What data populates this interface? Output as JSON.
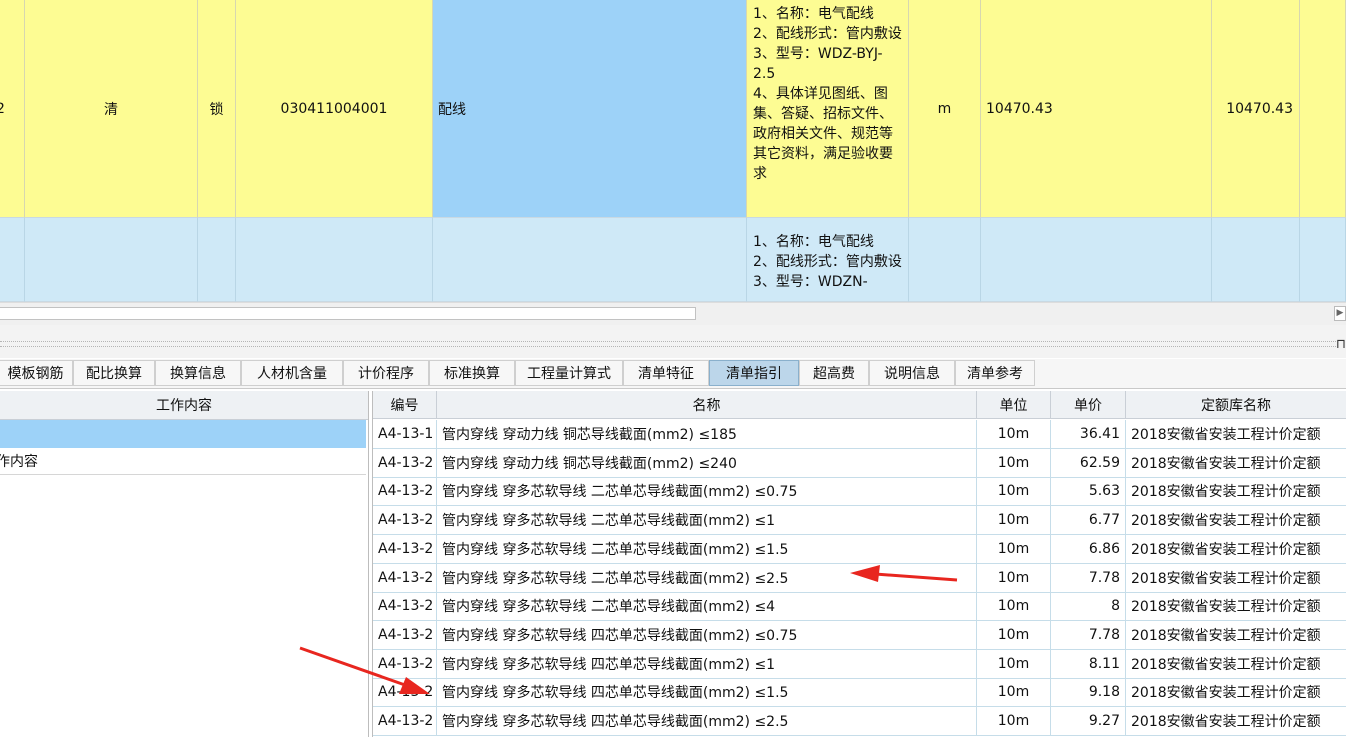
{
  "top_grid": {
    "row1": {
      "seq": "2",
      "type": "清",
      "lock": "锁",
      "code": "030411004001",
      "name": "配线",
      "features": [
        "1、名称：电气配线",
        "2、配线形式：管内敷设",
        "3、型号：WDZ-BYJ-2.5",
        "4、具体详见图纸、图集、答疑、招标文件、政府相关文件、规范等其它资料，满足验收要求"
      ],
      "unit": "m",
      "quantity": "10470.43",
      "quantity2": "10470.43"
    },
    "row2": {
      "features": [
        "1、名称：电气配线",
        "2、配线形式：管内敷设",
        "3、型号：WDZN-"
      ]
    }
  },
  "tabs": [
    {
      "label": "模板钢筋",
      "active": false
    },
    {
      "label": "配比换算",
      "active": false
    },
    {
      "label": "换算信息",
      "active": false
    },
    {
      "label": "人材机含量",
      "active": false
    },
    {
      "label": "计价程序",
      "active": false
    },
    {
      "label": "标准换算",
      "active": false
    },
    {
      "label": "工程量计算式",
      "active": false
    },
    {
      "label": "清单特征",
      "active": false
    },
    {
      "label": "清单指引",
      "active": true
    },
    {
      "label": "超高费",
      "active": false
    },
    {
      "label": "说明信息",
      "active": false
    },
    {
      "label": "清单参考",
      "active": false
    }
  ],
  "left_panel": {
    "header": "工作内容",
    "rows": [
      "",
      "作内容"
    ]
  },
  "quota_table": {
    "headers": [
      "编号",
      "名称",
      "单位",
      "单价",
      "定额库名称"
    ],
    "rows": [
      {
        "code": "A4-13-1",
        "name": "管内穿线 穿动力线 铜芯导线截面(mm2) ≤185",
        "unit": "10m",
        "price": "36.41",
        "lib": "2018安徽省安装工程计价定额"
      },
      {
        "code": "A4-13-2",
        "name": "管内穿线 穿动力线 铜芯导线截面(mm2) ≤240",
        "unit": "10m",
        "price": "62.59",
        "lib": "2018安徽省安装工程计价定额"
      },
      {
        "code": "A4-13-2",
        "name": "管内穿线 穿多芯软导线 二芯单芯导线截面(mm2) ≤0.75",
        "unit": "10m",
        "price": "5.63",
        "lib": "2018安徽省安装工程计价定额"
      },
      {
        "code": "A4-13-2",
        "name": "管内穿线 穿多芯软导线 二芯单芯导线截面(mm2) ≤1",
        "unit": "10m",
        "price": "6.77",
        "lib": "2018安徽省安装工程计价定额"
      },
      {
        "code": "A4-13-2",
        "name": "管内穿线 穿多芯软导线 二芯单芯导线截面(mm2) ≤1.5",
        "unit": "10m",
        "price": "6.86",
        "lib": "2018安徽省安装工程计价定额"
      },
      {
        "code": "A4-13-2",
        "name": "管内穿线 穿多芯软导线 二芯单芯导线截面(mm2) ≤2.5",
        "unit": "10m",
        "price": "7.78",
        "lib": "2018安徽省安装工程计价定额"
      },
      {
        "code": "A4-13-2",
        "name": "管内穿线 穿多芯软导线 二芯单芯导线截面(mm2) ≤4",
        "unit": "10m",
        "price": "8",
        "lib": "2018安徽省安装工程计价定额"
      },
      {
        "code": "A4-13-2",
        "name": "管内穿线 穿多芯软导线 四芯单芯导线截面(mm2) ≤0.75",
        "unit": "10m",
        "price": "7.78",
        "lib": "2018安徽省安装工程计价定额"
      },
      {
        "code": "A4-13-2",
        "name": "管内穿线 穿多芯软导线 四芯单芯导线截面(mm2) ≤1",
        "unit": "10m",
        "price": "8.11",
        "lib": "2018安徽省安装工程计价定额"
      },
      {
        "code": "A4-13-2",
        "name": "管内穿线 穿多芯软导线 四芯单芯导线截面(mm2) ≤1.5",
        "unit": "10m",
        "price": "9.18",
        "lib": "2018安徽省安装工程计价定额"
      },
      {
        "code": "A4-13-2",
        "name": "管内穿线 穿多芯软导线 四芯单芯导线截面(mm2) ≤2.5",
        "unit": "10m",
        "price": "9.27",
        "lib": "2018安徽省安装工程计价定额"
      }
    ]
  },
  "colors": {
    "highlight_row": "#fdfc93",
    "selected_cell": "#9dd2f8",
    "active_tab": "#bcd6ea",
    "annotation_arrow": "#e8261f"
  }
}
